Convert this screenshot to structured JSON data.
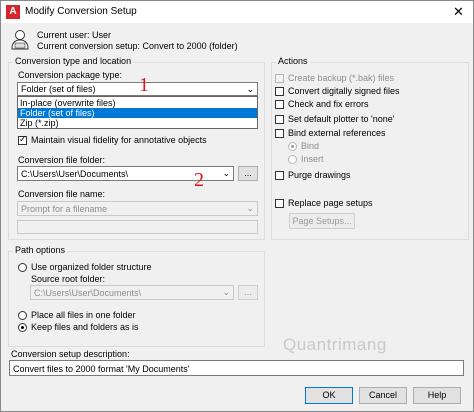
{
  "window": {
    "title": "Modify Conversion Setup",
    "app_icon_glyph": "A"
  },
  "header": {
    "current_user": "Current user: User",
    "current_setup": "Current conversion setup: Convert to 2000 (folder)"
  },
  "conversion_type": {
    "group_label": "Conversion type and location",
    "package_type_label": "Conversion package type:",
    "package_type_value": "Folder (set of files)",
    "options": [
      "In-place (overwrite files)",
      "Folder (set of files)",
      "Zip (*.zip)"
    ],
    "selected_index": 1,
    "fidelity_label": "Maintain visual fidelity for annotative objects",
    "fidelity_checked": true,
    "folder_label": "Conversion file folder:",
    "folder_value": "C:\\Users\\User\\Documents\\",
    "browse_label": "...",
    "name_label": "Conversion file name:",
    "name_value": "Prompt for a filename"
  },
  "path_options": {
    "group_label": "Path options",
    "use_organized": "Use organized folder structure",
    "source_root_label": "Source root folder:",
    "source_root_value": "C:\\Users\\User\\Documents\\",
    "browse_label": "...",
    "place_all": "Place all files in one folder",
    "keep_files": "Keep files and folders as is",
    "selected": "keep_files"
  },
  "actions": {
    "group_label": "Actions",
    "create_backup": "Create backup (*.bak) files",
    "convert_signed": "Convert digitally signed files",
    "check_fix": "Check and fix errors",
    "set_plotter": "Set default plotter to 'none'",
    "bind_xrefs": "Bind external references",
    "bind": "Bind",
    "insert": "Insert",
    "purge": "Purge drawings",
    "replace_page": "Replace page setups",
    "page_setups_button": "Page Setups..."
  },
  "description": {
    "label": "Conversion setup description:",
    "value": "Convert files to 2000 format 'My Documents'"
  },
  "buttons": {
    "ok": "OK",
    "cancel": "Cancel",
    "help": "Help"
  },
  "annotations": {
    "num1": "1",
    "num2": "2"
  },
  "watermark": "Quantrimang",
  "colors": {
    "selection": "#0078d7",
    "annotation_red": "#e1141a"
  }
}
